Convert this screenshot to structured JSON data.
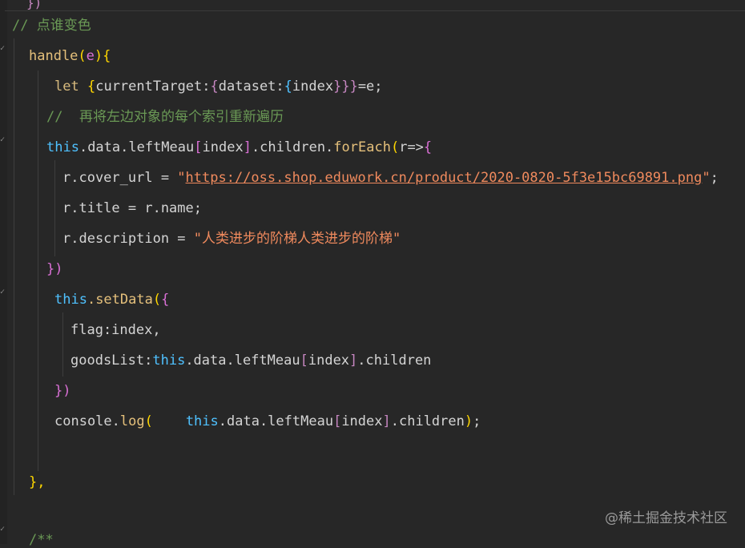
{
  "editor": {
    "lines": {
      "top_brace": "})",
      "comment1": "// 点谁变色",
      "handle_name": "handle",
      "handle_paren_open": "(",
      "handle_arg": "e",
      "handle_paren_close": ")",
      "handle_brace": "{",
      "let_kw": "let",
      "let_rest_a": " ",
      "let_b1": "{",
      "let_ct": "currentTarget:",
      "let_b2": "{",
      "let_ds": "dataset:",
      "let_b3": "{",
      "let_idx": "index",
      "let_close": "}}}",
      "let_tail": "=e;",
      "comment2": "//  再将左边对象的每个索引重新遍历",
      "this1": "this",
      "data1": ".data.leftMeau",
      "br1o": "[",
      "idx1": "index",
      "br1c": "]",
      "children1": ".children.",
      "foreach": "forEach",
      "fe_po": "(",
      "fe_r": "r=>",
      "fe_bo": "{",
      "cover_left": "r.cover_url = ",
      "cover_q1": "\"",
      "cover_url": "https://oss.shop.eduwork.cn/product/2020-0820-5f3e15bc69891.png",
      "cover_q2": "\"",
      "cover_semi": ";",
      "title_line": "r.title = r.name;",
      "desc_left": "r.description = ",
      "desc_str": "\"人类进步的阶梯人类进步的阶梯\"",
      "close1": "})",
      "this2": "this",
      "setdata": ".setData",
      "sd_po": "(",
      "sd_bo": "{",
      "flag_line": "flag:index,",
      "goods_left": "goodsList:",
      "this3": "this",
      "goods_mid": ".data.leftMeau",
      "br2o": "[",
      "idx2": "index",
      "br2c": "]",
      "goods_tail": ".children",
      "close2": "})",
      "console_left": "console.",
      "log": "log",
      "log_po": "(",
      "log_space": "    ",
      "this4": "this",
      "log_mid": ".data.leftMeau",
      "br3o": "[",
      "idx3": "index",
      "br3c": "]",
      "log_tail": ".children",
      "log_pc": ")",
      "log_semi": ";",
      "close3": "},",
      "doc_start": "/**"
    }
  },
  "watermark": "@稀土掘金技术社区",
  "colors": {
    "background": "#272727",
    "keyword": "#d7ba7d",
    "function": "#e5c07b",
    "this": "#4fc1ff",
    "comment": "#6a9955",
    "string": "#f08a5d"
  }
}
